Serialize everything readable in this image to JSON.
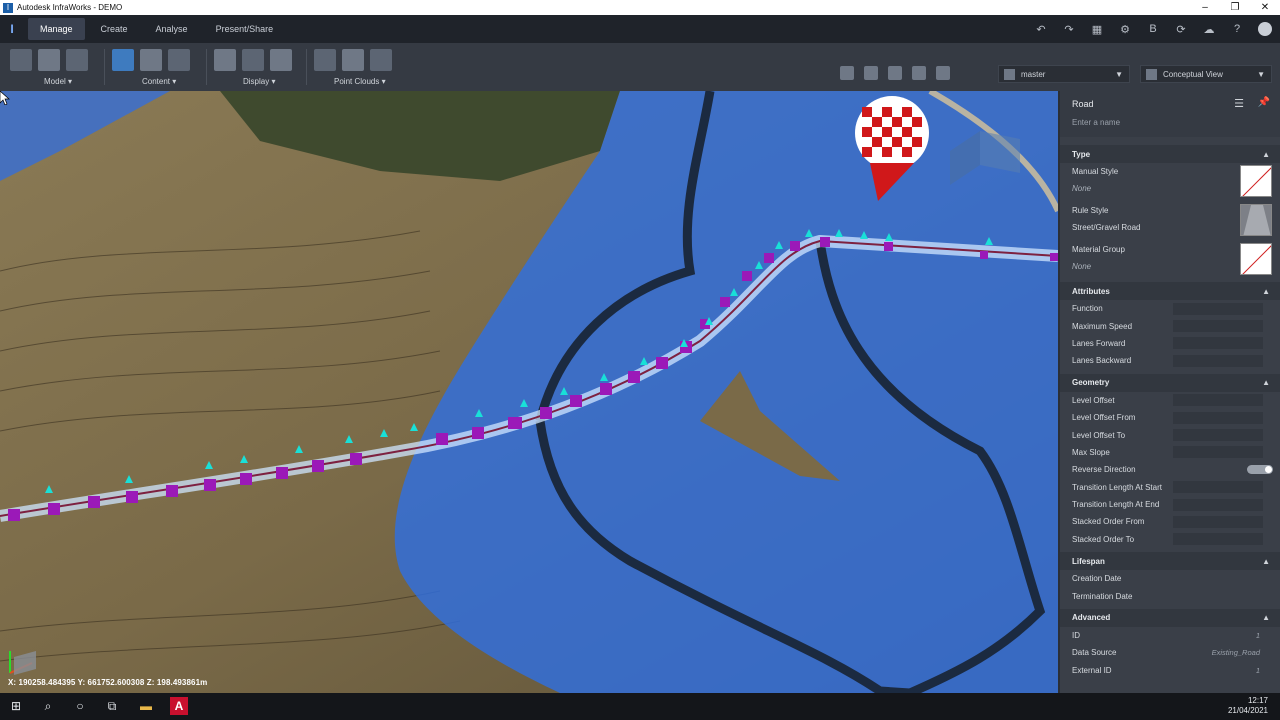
{
  "window": {
    "title": "Autodesk InfraWorks - DEMO",
    "controls": [
      "–",
      "❐",
      "✕"
    ]
  },
  "ribbon": {
    "tabs": [
      "Manage",
      "Create",
      "Analyse",
      "Present/Share"
    ],
    "active_tab": "Manage",
    "groups": [
      {
        "label": "Model ▾"
      },
      {
        "label": "Content ▾"
      },
      {
        "label": "Display ▾"
      },
      {
        "label": "Point Clouds ▾"
      }
    ]
  },
  "toolbar": {
    "proposal": "master",
    "view_mode": "Conceptual View"
  },
  "viewport": {
    "coordinates": "X: 190258.484395 Y: 661752.600308 Z: 198.493861m"
  },
  "panel": {
    "title": "Road",
    "name_placeholder": "Enter a name",
    "sections": {
      "type": "Type",
      "attributes": "Attributes",
      "geometry": "Geometry",
      "lifespan": "Lifespan",
      "advanced": "Advanced"
    },
    "type_items": [
      {
        "label": "Manual Style",
        "value": "None"
      },
      {
        "label": "Rule Style",
        "value": "Street/Gravel Road"
      },
      {
        "label": "Material Group",
        "value": "None"
      }
    ],
    "attributes": [
      "Function",
      "Maximum Speed",
      "Lanes Forward",
      "Lanes Backward"
    ],
    "geometry": [
      "Level Offset",
      "Level Offset From",
      "Level Offset To",
      "Max Slope",
      "Reverse Direction",
      "Transition Length At Start",
      "Transition Length At End",
      "Stacked Order From",
      "Stacked Order To"
    ],
    "lifespan": [
      "Creation Date",
      "Termination Date"
    ],
    "advanced": [
      {
        "label": "ID",
        "value": "1"
      },
      {
        "label": "Data Source",
        "value": "Existing_Road"
      },
      {
        "label": "External ID",
        "value": "1"
      }
    ]
  },
  "taskbar": {
    "time": "12:17",
    "date": "21/04/2021"
  },
  "colors": {
    "flood": "#2f6fe0",
    "road_markers": "#9b19b8",
    "markers_top": "#19e0d8",
    "terrain": "#7a6a4a"
  }
}
